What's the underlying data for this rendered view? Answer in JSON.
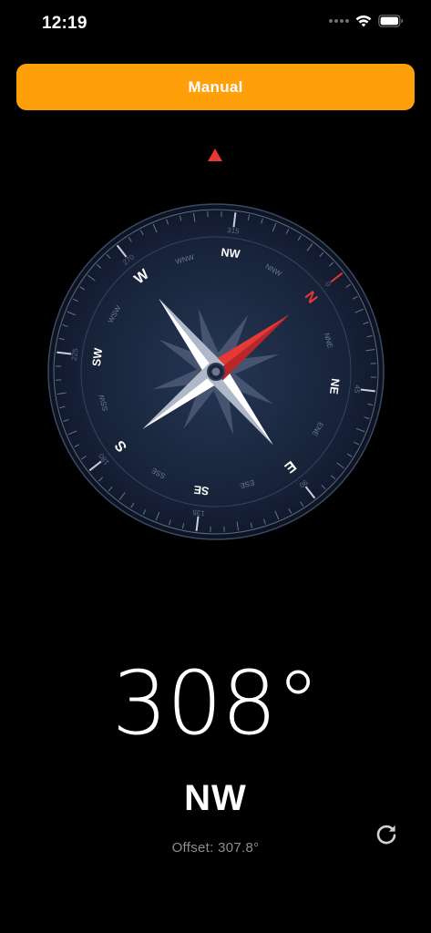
{
  "status_bar": {
    "time": "12:19",
    "icons": [
      "signal-dots-icon",
      "wifi-icon",
      "battery-icon"
    ]
  },
  "mode_button": {
    "label": "Manual",
    "color": "#ff9f0a"
  },
  "compass": {
    "heading_deg": 308,
    "accent_color": "#e53935",
    "dial_labels": [
      "N",
      "NNE",
      "NE",
      "ENE",
      "E",
      "ESE",
      "SE",
      "SSE",
      "S",
      "SSW",
      "SW",
      "WSW",
      "W",
      "WNW",
      "NW",
      "NNW"
    ],
    "degree_labels": [
      "0",
      "45",
      "90",
      "135",
      "180",
      "225",
      "270",
      "315"
    ]
  },
  "readout": {
    "degrees": "308°",
    "direction": "NW",
    "offset": "Offset: 307.8°"
  },
  "reset_button": {
    "icon": "refresh-icon"
  }
}
